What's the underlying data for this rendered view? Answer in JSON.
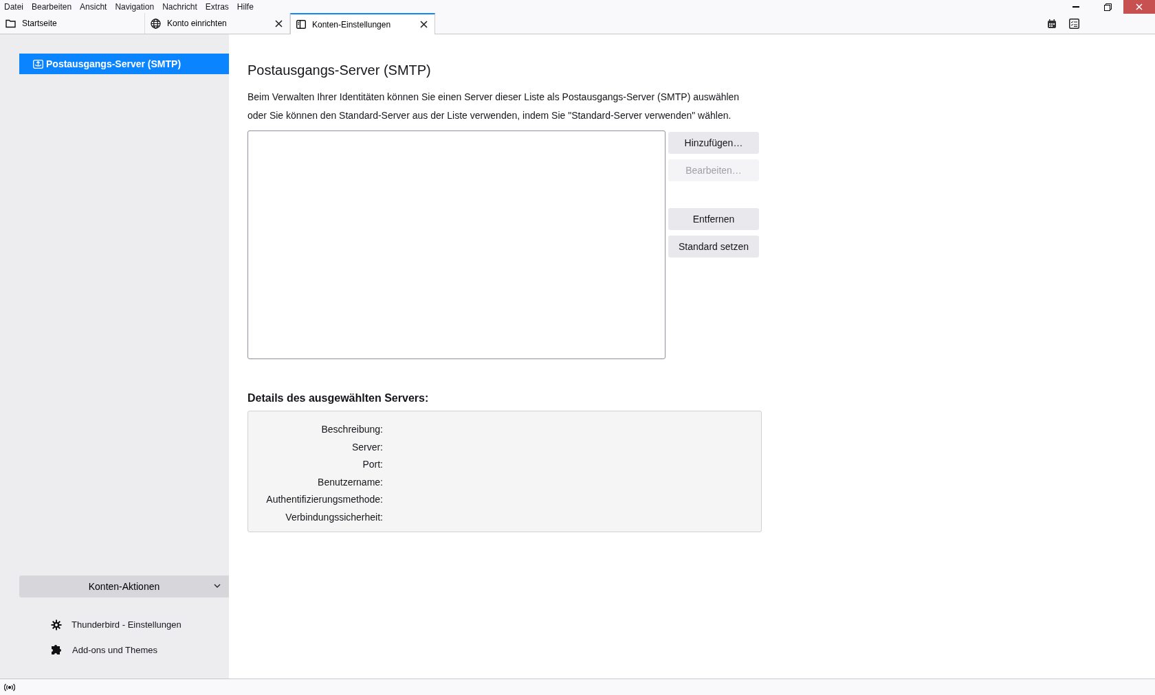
{
  "menu_bar": [
    "Datei",
    "Bearbeiten",
    "Ansicht",
    "Navigation",
    "Nachricht",
    "Extras",
    "Hilfe"
  ],
  "tabs": [
    {
      "label": "Startseite",
      "kind": "folder",
      "closable": false,
      "selected": false
    },
    {
      "label": "Konto einrichten",
      "kind": "globe",
      "closable": true,
      "selected": false
    },
    {
      "label": "Konten-Einstellungen",
      "kind": "panel",
      "closable": true,
      "selected": true
    }
  ],
  "sidebar": {
    "items": [
      {
        "label": "Postausgangs-Server (SMTP)",
        "selected": true
      }
    ],
    "account_actions": "Konten-Aktionen",
    "links": [
      {
        "label": "Thunderbird - Einstellungen",
        "kind": "gear"
      },
      {
        "label": "Add-ons und Themes",
        "kind": "puzzle"
      }
    ]
  },
  "page": {
    "title": "Postausgangs-Server (SMTP)",
    "description": "Beim Verwalten Ihrer Identitäten können Sie einen Server dieser Liste als Postausgangs-Server (SMTP) auswählen oder Sie können den Standard-Server aus der Liste verwenden, indem Sie \"Standard-Server verwenden\" wählen.",
    "buttons": [
      {
        "label": "Hinzufügen…",
        "disabled": false
      },
      {
        "label": "Bearbeiten…",
        "disabled": true
      },
      {
        "label": "Entfernen",
        "disabled": false
      },
      {
        "label": "Standard setzen",
        "disabled": false
      }
    ],
    "details_heading": "Details des ausgewählten Servers:",
    "details": [
      "Beschreibung:",
      "Server:",
      "Port:",
      "Benutzername:",
      "Authentifizierungsmethode:",
      "Verbindungssicherheit:"
    ]
  }
}
